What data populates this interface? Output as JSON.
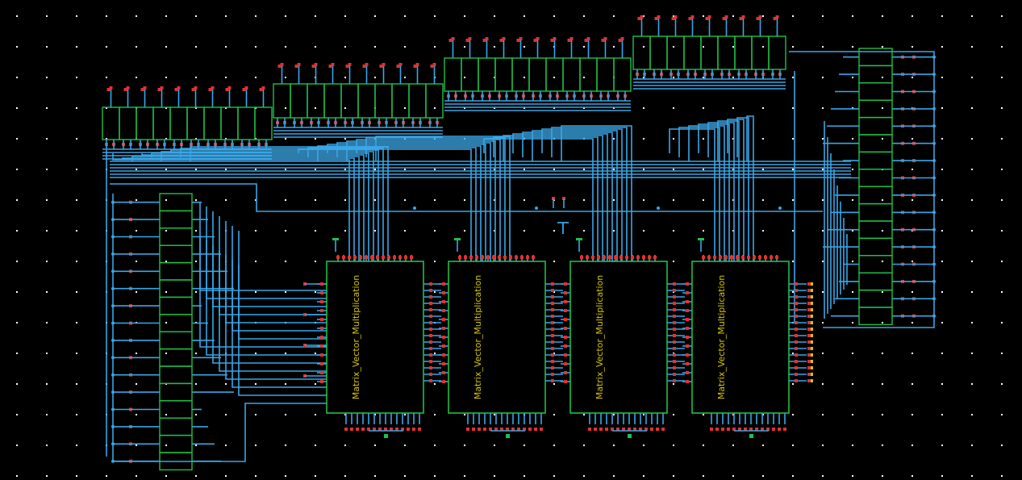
{
  "canvas": {
    "background": "#000000",
    "grid_dot_color": "#ffffff"
  },
  "colors": {
    "wire": "#3aa6e6",
    "instance_outline": "#1fbf4a",
    "pin": "#e23131",
    "label": "#d6c400",
    "dot": "#ffffff"
  },
  "instances": [
    {
      "label": "Matrix_Vector_Multiplication"
    },
    {
      "label": "Matrix_Vector_Multiplication"
    },
    {
      "label": "Matrix_Vector_Multiplication"
    },
    {
      "label": "Matrix_Vector_Multiplication"
    }
  ],
  "icons": [
    "ground-symbol-icon",
    "port-pin-icon",
    "supply-tee-icon"
  ]
}
